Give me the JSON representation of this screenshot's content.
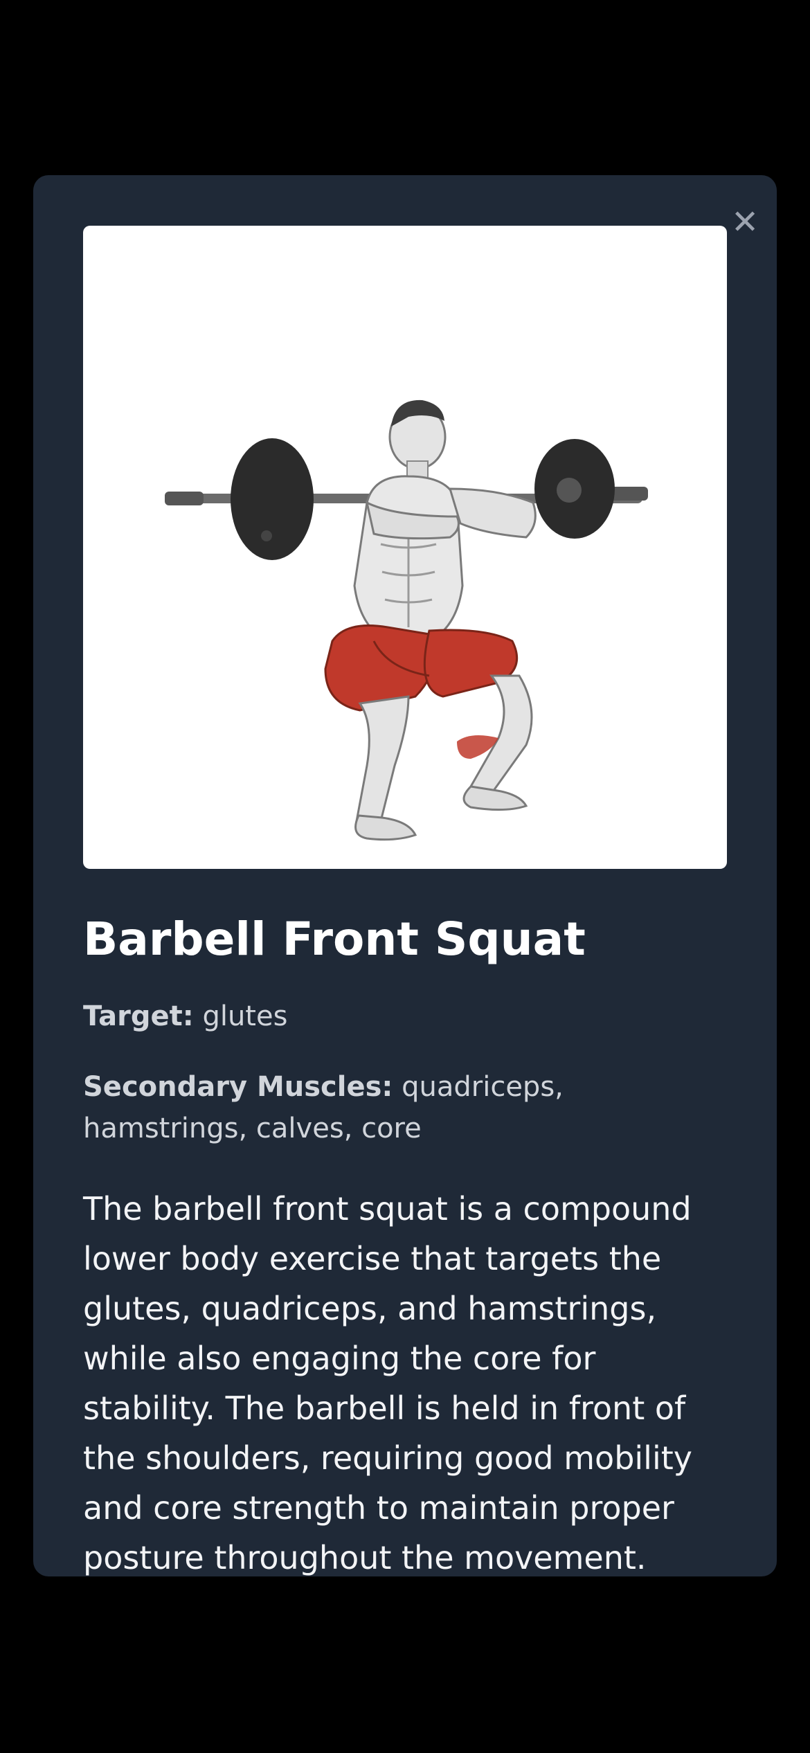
{
  "modal": {
    "close_symbol": "✕",
    "image": {
      "alt": "Barbell front squat illustration",
      "muscle_highlight_color": "#c0392b"
    },
    "title": "Barbell Front Squat",
    "target_label": "Target:",
    "target_value": "glutes",
    "secondary_label": "Secondary Muscles:",
    "secondary_value": "quadriceps, hamstrings, calves, core",
    "description": "The barbell front squat is a compound lower body exercise that targets the glutes, quadriceps, and hamstrings, while also engaging the core for stability. The barbell is held in front of the shoulders, requiring good mobility and core strength to maintain proper posture throughout the movement."
  },
  "colors": {
    "backdrop": "#000000",
    "modal_bg": "#1f2937",
    "title": "#ffffff",
    "text": "#d1d5db"
  },
  "icons": {
    "close": "close-icon"
  }
}
